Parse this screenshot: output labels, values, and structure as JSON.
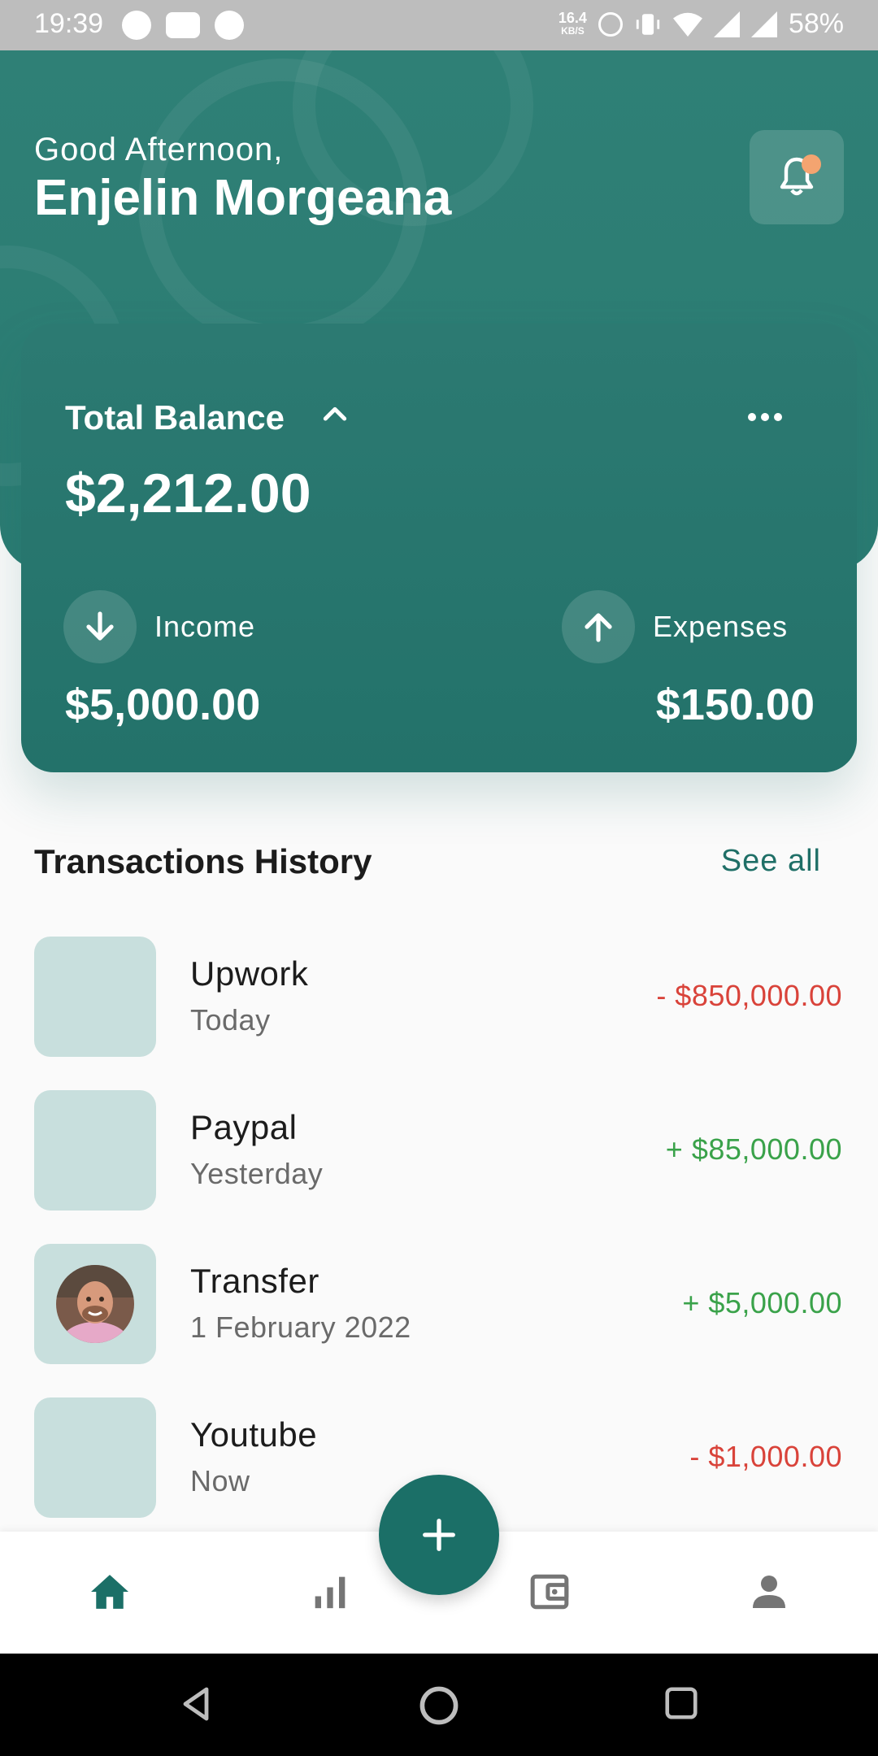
{
  "status_bar": {
    "time": "19:39",
    "net_speed_value": "16.4",
    "net_speed_unit": "KB/S",
    "battery": "58%"
  },
  "header": {
    "greeting": "Good Afternoon,",
    "user_name": "Enjelin Morgeana",
    "notification_dot_color": "#f4a470"
  },
  "balance_card": {
    "title": "Total Balance",
    "balance": "$2,212.00",
    "income_label": "Income",
    "income_amount": "$5,000.00",
    "expenses_label": "Expenses",
    "expenses_amount": "$150.00"
  },
  "transactions": {
    "title": "Transactions History",
    "see_all": "See all",
    "items": [
      {
        "name": "Upwork",
        "date": "Today",
        "amount": "- $850,000.00",
        "type": "negative"
      },
      {
        "name": "Paypal",
        "date": "Yesterday",
        "amount": "+ $85,000.00",
        "type": "positive"
      },
      {
        "name": "Transfer",
        "date": "1 February 2022",
        "amount": "+ $5,000.00",
        "type": "positive"
      },
      {
        "name": "Youtube",
        "date": "Now",
        "amount": "- $1,000.00",
        "type": "negative"
      }
    ]
  },
  "bottom_nav": {
    "items": [
      "home-icon",
      "stats-icon",
      "wallet-icon",
      "profile-icon"
    ],
    "active": "home-icon"
  },
  "colors": {
    "primary": "#1b6f67",
    "header_bg": "#2f8076",
    "negative": "#d9433a",
    "positive": "#3aa24a"
  }
}
